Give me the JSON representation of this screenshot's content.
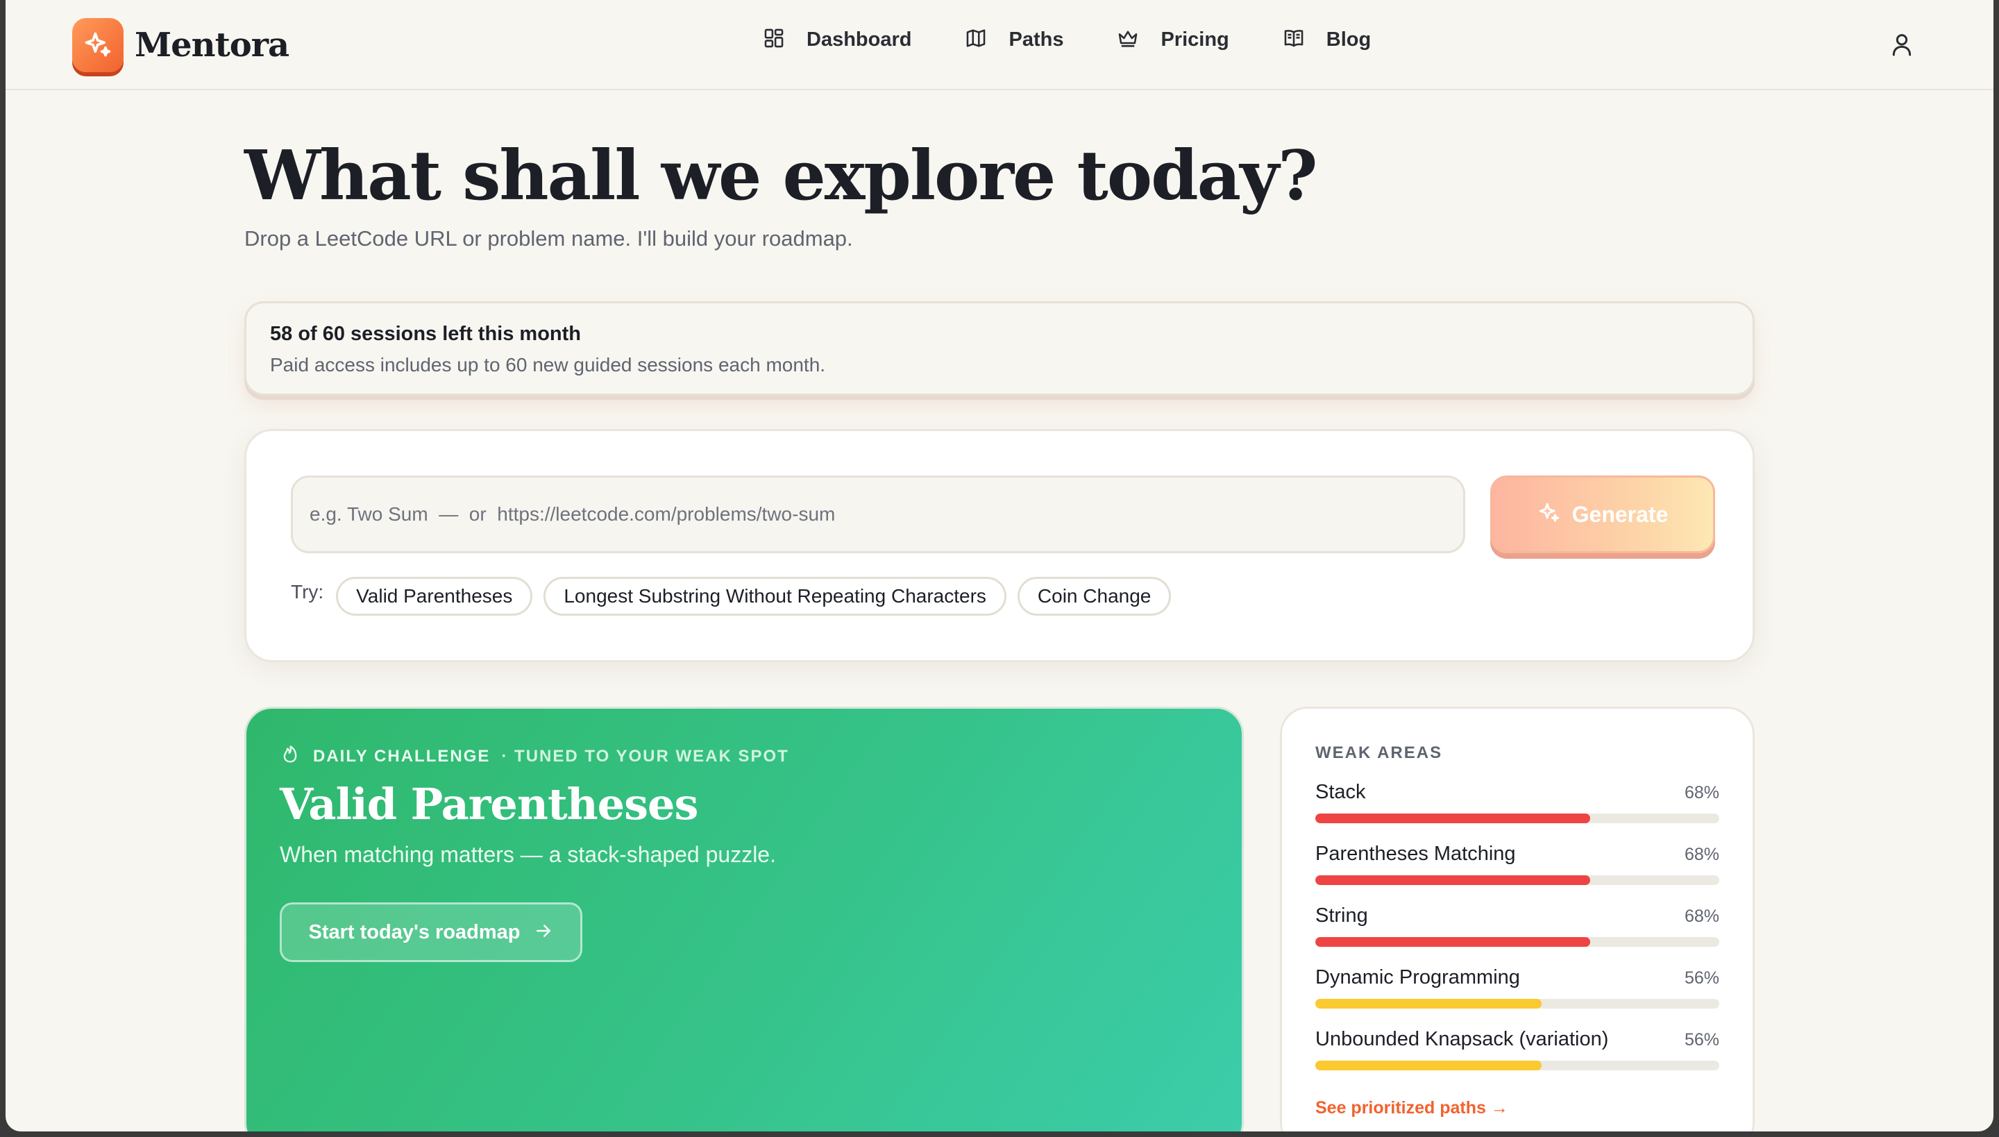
{
  "app": {
    "brand": "Mentora"
  },
  "nav": {
    "items": [
      {
        "label": "Dashboard",
        "icon": "dashboard-grid-icon"
      },
      {
        "label": "Paths",
        "icon": "map-icon"
      },
      {
        "label": "Pricing",
        "icon": "crown-icon"
      },
      {
        "label": "Blog",
        "icon": "open-book-icon"
      }
    ],
    "user_icon": "user-icon"
  },
  "hero": {
    "title": "What shall we explore today?",
    "subtitle": "Drop a LeetCode URL or problem name. I'll build your roadmap."
  },
  "sessions": {
    "title": "58 of 60 sessions left this month",
    "description": "Paid access includes up to 60 new guided sessions each month."
  },
  "search": {
    "placeholder": "e.g. Two Sum  —  or  https://leetcode.com/problems/two-sum",
    "value": "",
    "generate_label": "Generate",
    "try_label": "Try:",
    "suggestions": [
      "Valid Parentheses",
      "Longest Substring Without Repeating Characters",
      "Coin Change"
    ]
  },
  "challenge": {
    "kicker": "DAILY CHALLENGE",
    "kicker_sub": "· TUNED TO YOUR WEAK SPOT",
    "title": "Valid Parentheses",
    "description": "When matching matters — a stack-shaped puzzle.",
    "button_label": "Start today's roadmap",
    "colors": {
      "gradient_start": "#2fb86c",
      "gradient_end": "#3ccdab"
    }
  },
  "weak_areas": {
    "title": "WEAK AREAS",
    "items": [
      {
        "label": "Stack",
        "percent_text": "68%",
        "percent": 68,
        "color": "#ef4444"
      },
      {
        "label": "Parentheses Matching",
        "percent_text": "68%",
        "percent": 68,
        "color": "#ef4444"
      },
      {
        "label": "String",
        "percent_text": "68%",
        "percent": 68,
        "color": "#ef4444"
      },
      {
        "label": "Dynamic Programming",
        "percent_text": "56%",
        "percent": 56,
        "color": "#fbc930"
      },
      {
        "label": "Unbounded Knapsack (variation)",
        "percent_text": "56%",
        "percent": 56,
        "color": "#fbc930"
      }
    ],
    "link_label": "See prioritized paths →"
  },
  "theme": {
    "accent": "#f2622e",
    "background": "#f8f6f1"
  }
}
